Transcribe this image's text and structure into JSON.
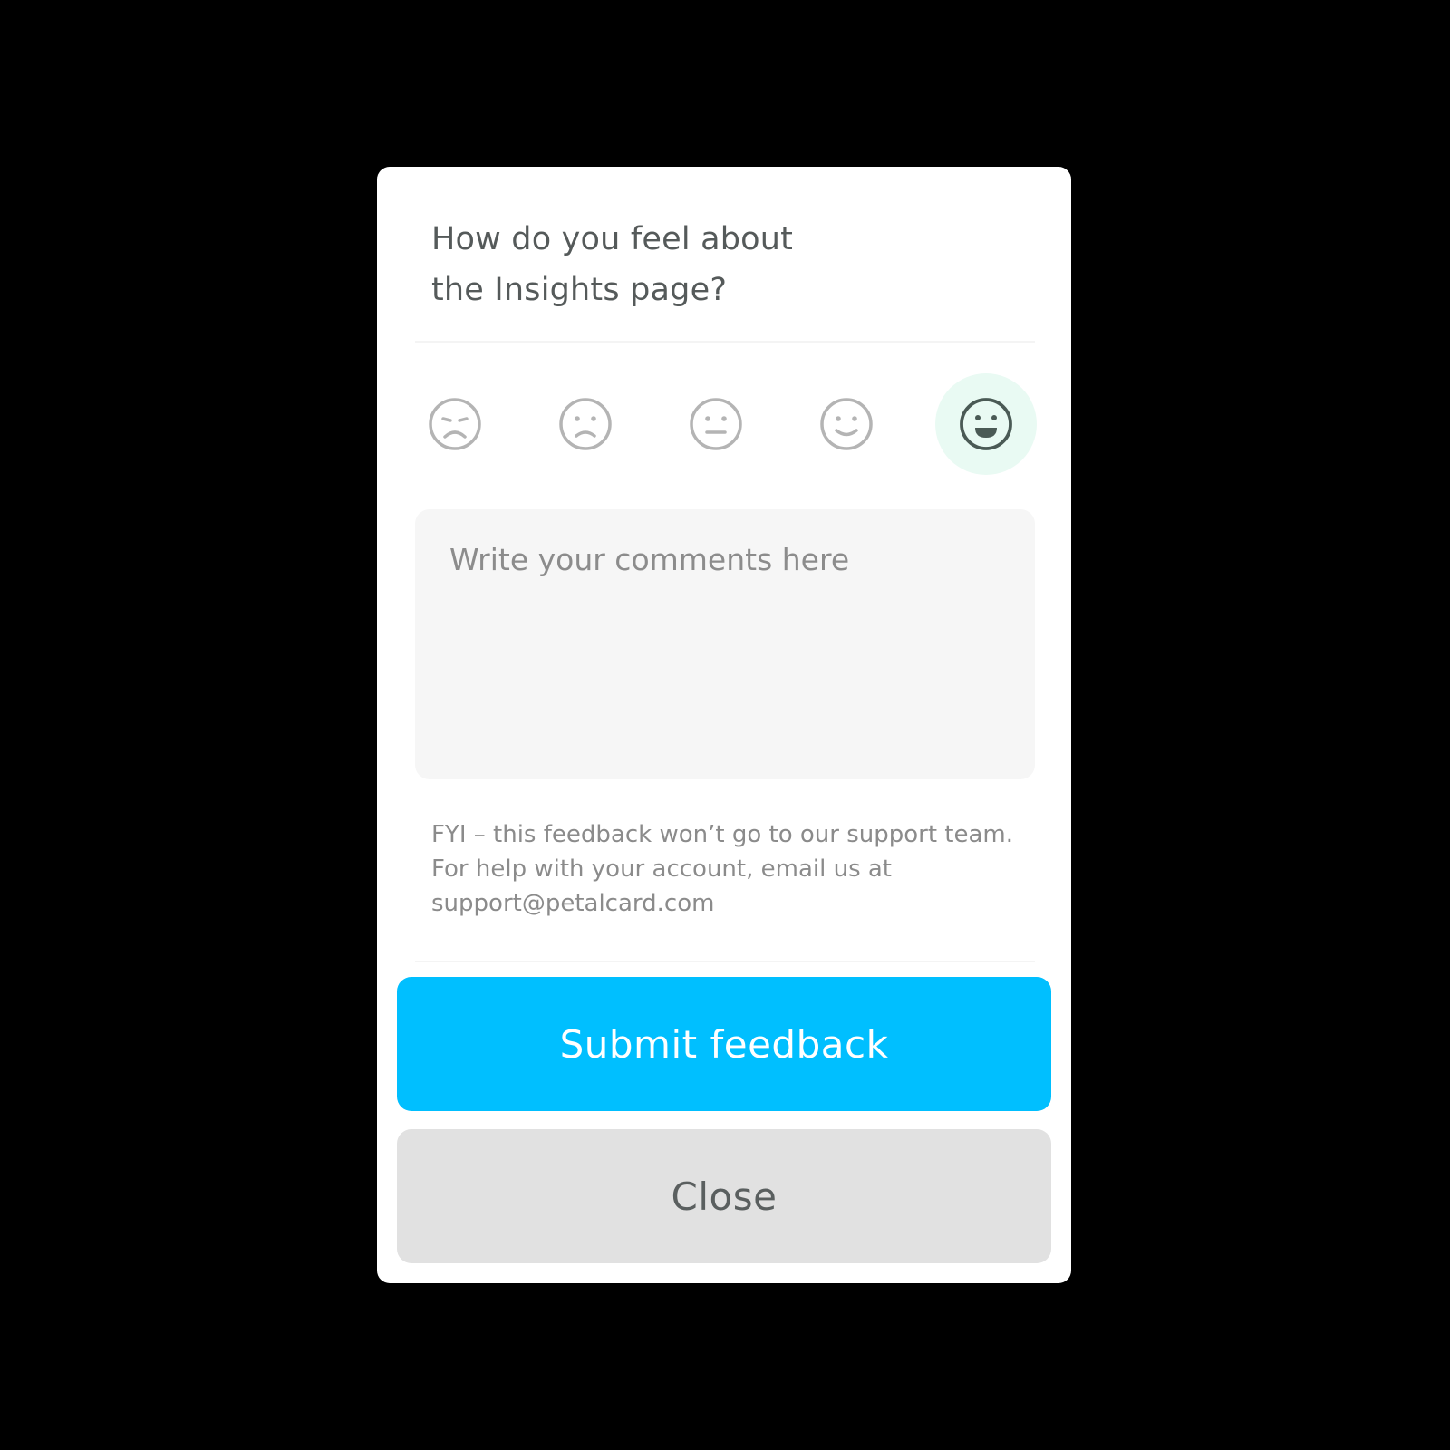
{
  "dialog": {
    "title_line1": "How do you feel about",
    "title_line2": "the Insights page?"
  },
  "rating": {
    "selected_index": 4,
    "options": [
      {
        "icon": "very-sad-face-icon"
      },
      {
        "icon": "sad-face-icon"
      },
      {
        "icon": "neutral-face-icon"
      },
      {
        "icon": "smile-face-icon"
      },
      {
        "icon": "happy-face-icon"
      }
    ],
    "colors": {
      "inactive": "#b4b4b4",
      "active": "#4a5a55",
      "active_bg": "#e9faf3"
    }
  },
  "comment": {
    "placeholder": "Write your comments here",
    "value": ""
  },
  "note": {
    "text": "FYI – this feedback won’t go to our support team. For help with your account, email us at ",
    "email": "support@petalcard.com"
  },
  "actions": {
    "submit_label": "Submit feedback",
    "close_label": "Close",
    "submit_color": "#00bfff",
    "close_color": "#e1e1e1"
  }
}
